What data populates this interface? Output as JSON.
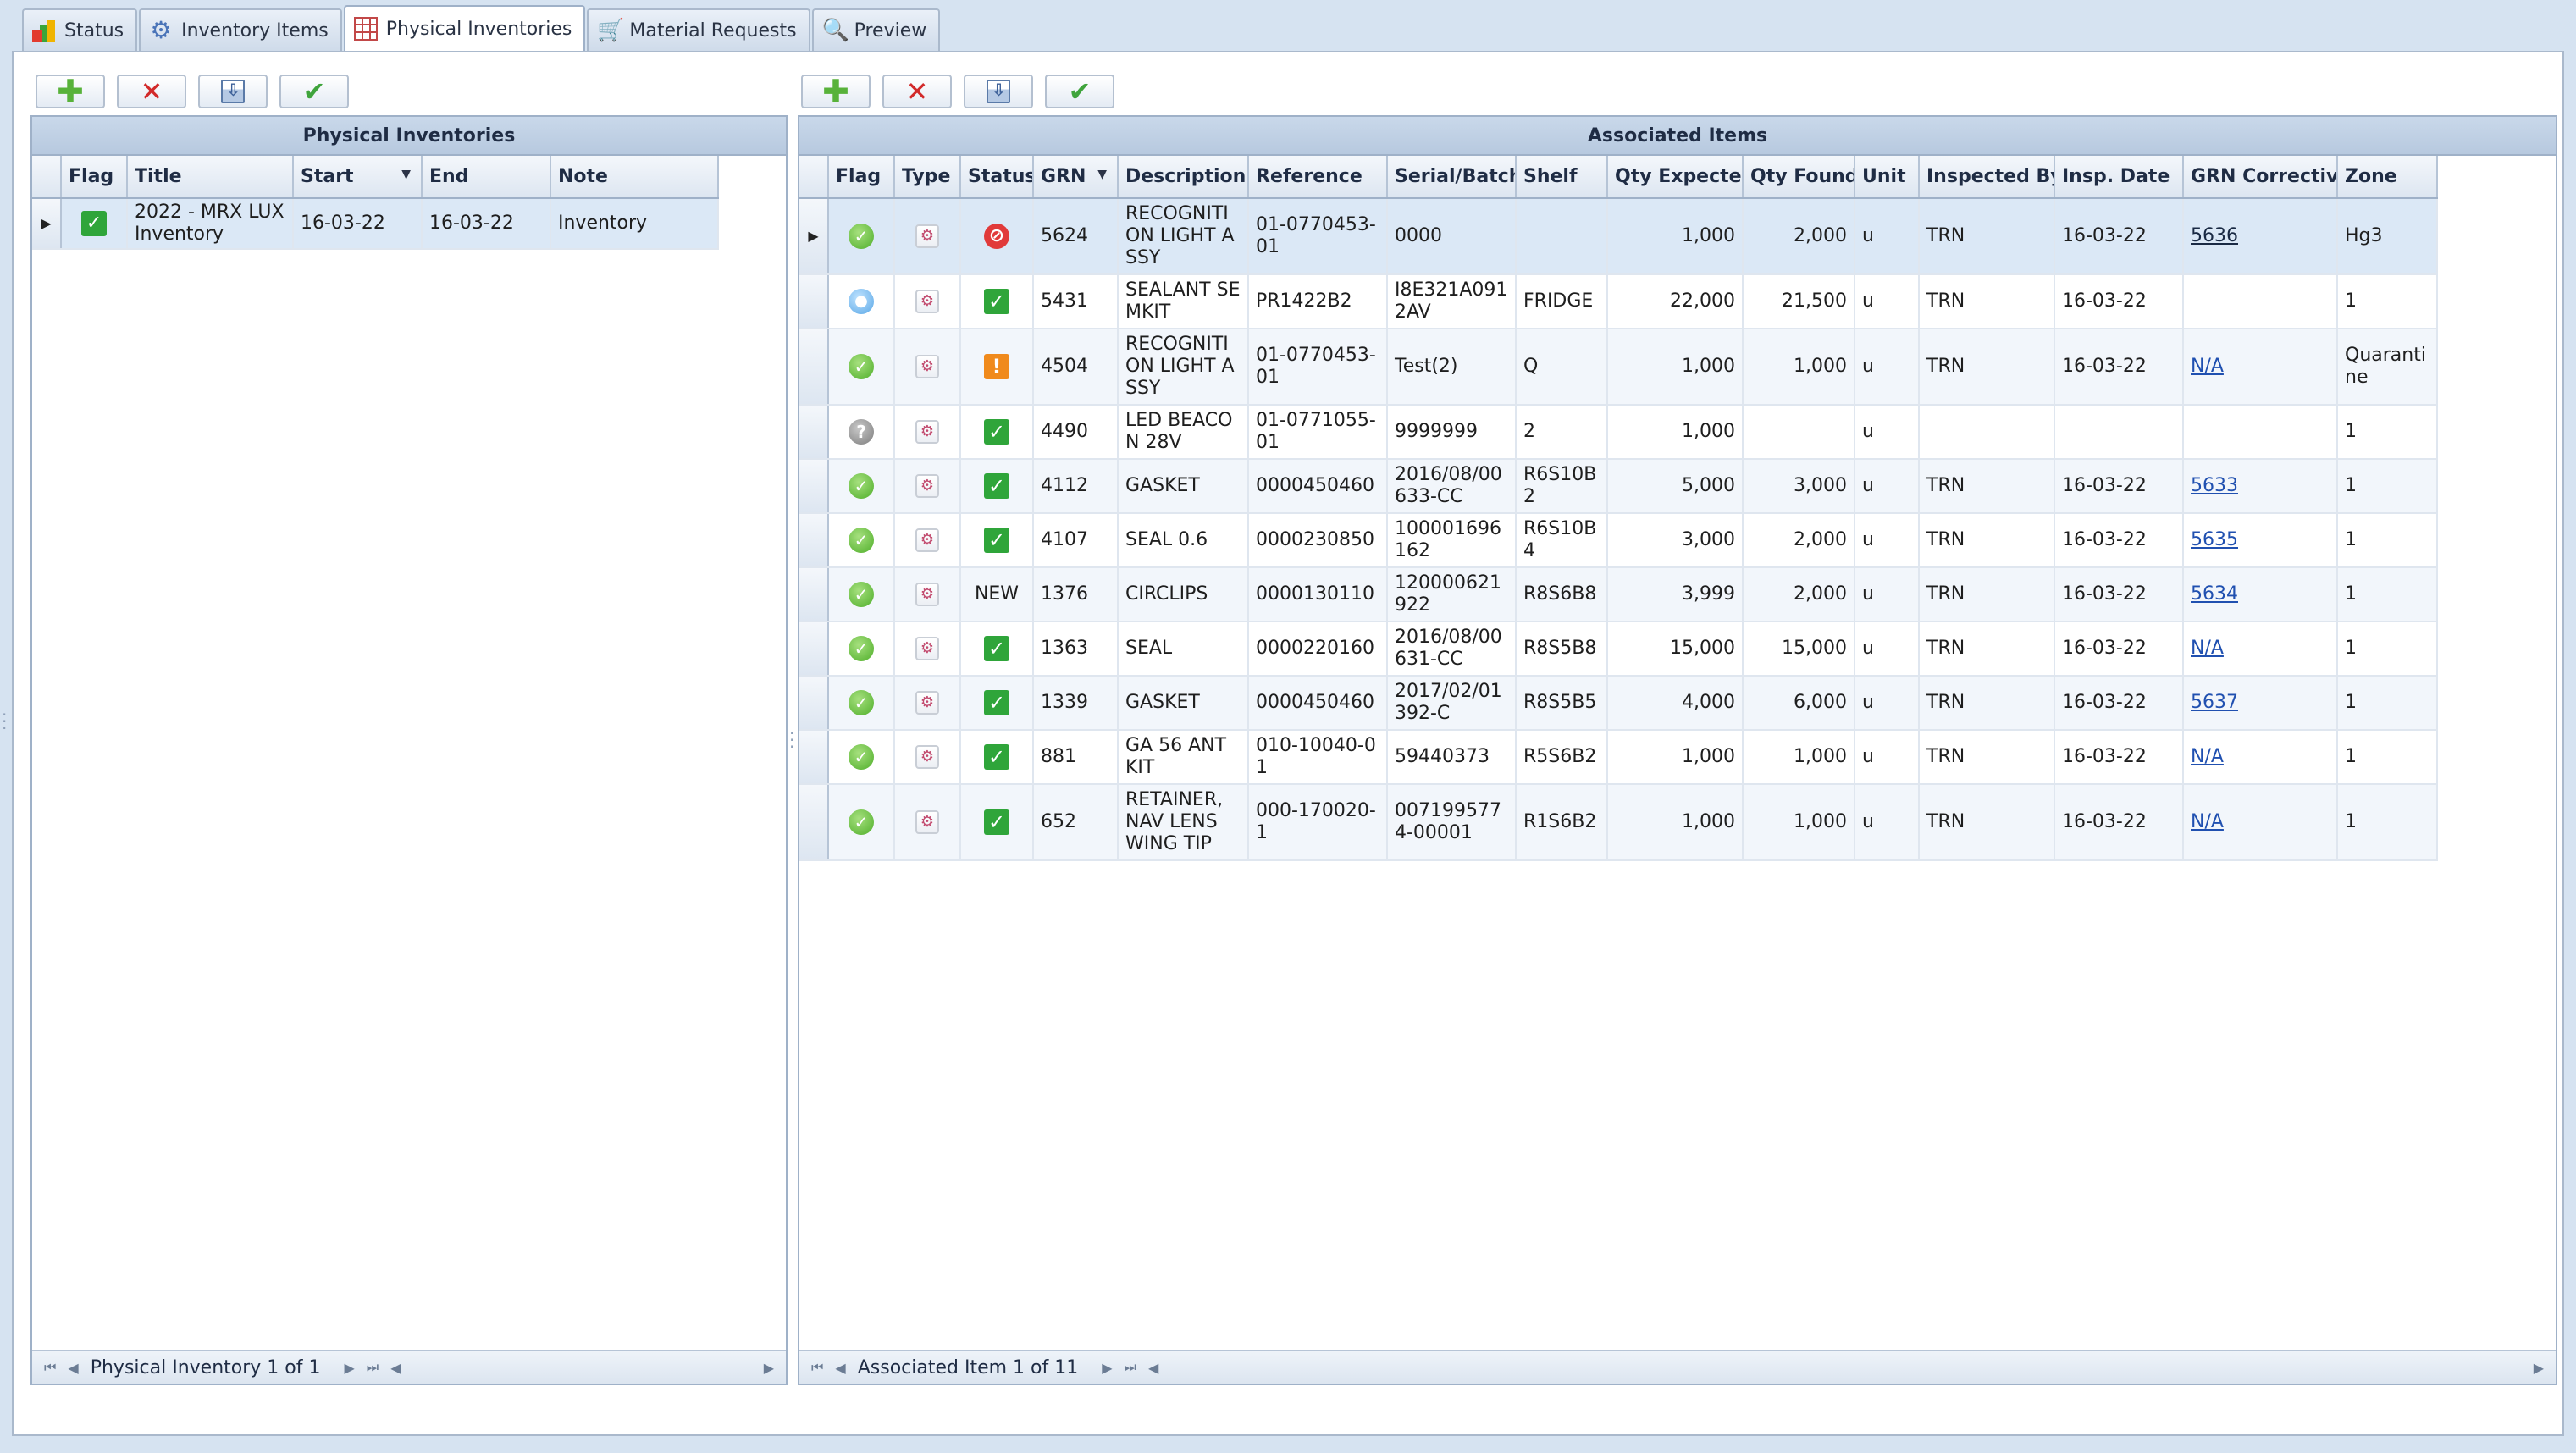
{
  "tabs": [
    {
      "label": "Status",
      "icon": "status-chart-icon"
    },
    {
      "label": "Inventory Items",
      "icon": "gear-icon"
    },
    {
      "label": "Physical Inventories",
      "icon": "grid-icon"
    },
    {
      "label": "Material Requests",
      "icon": "cart-icon"
    },
    {
      "label": "Preview",
      "icon": "magnifier-icon"
    }
  ],
  "left_panel": {
    "title": "Physical Inventories",
    "columns": [
      "Flag",
      "Title",
      "Start",
      "End",
      "Note"
    ],
    "rows": [
      {
        "flag": "check",
        "title": "2022 - MRX LUX Inventory",
        "start": "16-03-22",
        "end": "16-03-22",
        "note": "Inventory"
      }
    ],
    "navigator": "Physical Inventory 1 of 1"
  },
  "right_panel": {
    "title": "Associated Items",
    "columns": [
      "Flag",
      "Type",
      "Status",
      "GRN",
      "Description",
      "Reference",
      "Serial/Batch",
      "Shelf",
      "Qty Expected",
      "Qty Found",
      "Unit",
      "Inspected By",
      "Insp. Date",
      "GRN Corrective",
      "Zone"
    ],
    "rows": [
      {
        "flag": "ok",
        "status": "stop",
        "grn": "5624",
        "description": "RECOGNITION LIGHT ASSY",
        "reference": "01-0770453-01",
        "serial": "0000",
        "shelf": "",
        "qty_expected": "1,000",
        "qty_found": "2,000",
        "unit": "u",
        "inspected_by": "TRN",
        "insp_date": "16-03-22",
        "grn_corrective": "5636",
        "zone": "Hg3"
      },
      {
        "flag": "info",
        "status": "check",
        "grn": "5431",
        "description": "SEALANT SEMKIT",
        "reference": "PR1422B2",
        "serial": "I8E321A0912AV",
        "shelf": "FRIDGE",
        "qty_expected": "22,000",
        "qty_found": "21,500",
        "unit": "u",
        "inspected_by": "TRN",
        "insp_date": "16-03-22",
        "grn_corrective": "",
        "zone": "1"
      },
      {
        "flag": "ok",
        "status": "warn",
        "grn": "4504",
        "description": "RECOGNITION LIGHT ASSY",
        "reference": "01-0770453-01",
        "serial": "Test(2)",
        "shelf": "Q",
        "qty_expected": "1,000",
        "qty_found": "1,000",
        "unit": "u",
        "inspected_by": "TRN",
        "insp_date": "16-03-22",
        "grn_corrective": "N/A",
        "zone": "Quarantine"
      },
      {
        "flag": "question",
        "status": "check",
        "grn": "4490",
        "description": "LED BEACON 28V",
        "reference": "01-0771055-01",
        "serial": "9999999",
        "shelf": "2",
        "qty_expected": "1,000",
        "qty_found": "",
        "unit": "u",
        "inspected_by": "",
        "insp_date": "",
        "grn_corrective": "",
        "zone": "1"
      },
      {
        "flag": "ok",
        "status": "check",
        "grn": "4112",
        "description": "GASKET",
        "reference": "0000450460",
        "serial": "2016/08/00633-CC",
        "shelf": "R6S10B2",
        "qty_expected": "5,000",
        "qty_found": "3,000",
        "unit": "u",
        "inspected_by": "TRN",
        "insp_date": "16-03-22",
        "grn_corrective": "5633",
        "zone": "1"
      },
      {
        "flag": "ok",
        "status": "check",
        "grn": "4107",
        "description": "SEAL 0.6",
        "reference": "0000230850",
        "serial": "100001696162",
        "shelf": "R6S10B4",
        "qty_expected": "3,000",
        "qty_found": "2,000",
        "unit": "u",
        "inspected_by": "TRN",
        "insp_date": "16-03-22",
        "grn_corrective": "5635",
        "zone": "1"
      },
      {
        "flag": "ok",
        "status": "NEW",
        "grn": "1376",
        "description": "CIRCLIPS",
        "reference": "0000130110",
        "serial": "120000621922",
        "shelf": "R8S6B8",
        "qty_expected": "3,999",
        "qty_found": "2,000",
        "unit": "u",
        "inspected_by": "TRN",
        "insp_date": "16-03-22",
        "grn_corrective": "5634",
        "zone": "1"
      },
      {
        "flag": "ok",
        "status": "check",
        "grn": "1363",
        "description": "SEAL",
        "reference": "0000220160",
        "serial": "2016/08/00631-CC",
        "shelf": "R8S5B8",
        "qty_expected": "15,000",
        "qty_found": "15,000",
        "unit": "u",
        "inspected_by": "TRN",
        "insp_date": "16-03-22",
        "grn_corrective": "N/A",
        "zone": "1"
      },
      {
        "flag": "ok",
        "status": "check",
        "grn": "1339",
        "description": "GASKET",
        "reference": "0000450460",
        "serial": "2017/02/01392-C",
        "shelf": "R8S5B5",
        "qty_expected": "4,000",
        "qty_found": "6,000",
        "unit": "u",
        "inspected_by": "TRN",
        "insp_date": "16-03-22",
        "grn_corrective": "5637",
        "zone": "1"
      },
      {
        "flag": "ok",
        "status": "check",
        "grn": "881",
        "description": "GA 56 ANT KIT",
        "reference": "010-10040-01",
        "serial": "59440373",
        "shelf": "R5S6B2",
        "qty_expected": "1,000",
        "qty_found": "1,000",
        "unit": "u",
        "inspected_by": "TRN",
        "insp_date": "16-03-22",
        "grn_corrective": "N/A",
        "zone": "1"
      },
      {
        "flag": "ok",
        "status": "check",
        "grn": "652",
        "description": "RETAINER, NAV LENS WING TIP",
        "reference": "000-170020-1",
        "serial": "0071995774-00001",
        "shelf": "R1S6B2",
        "qty_expected": "1,000",
        "qty_found": "1,000",
        "unit": "u",
        "inspected_by": "TRN",
        "insp_date": "16-03-22",
        "grn_corrective": "N/A",
        "zone": "1"
      }
    ],
    "navigator": "Associated Item 1 of 11"
  },
  "colors": {
    "accent": "#dbe8f6",
    "header": "#b7c9df",
    "link": "#2050b0",
    "ok": "#4fae2a",
    "error": "#e13a3a",
    "warning": "#f08a1c"
  }
}
